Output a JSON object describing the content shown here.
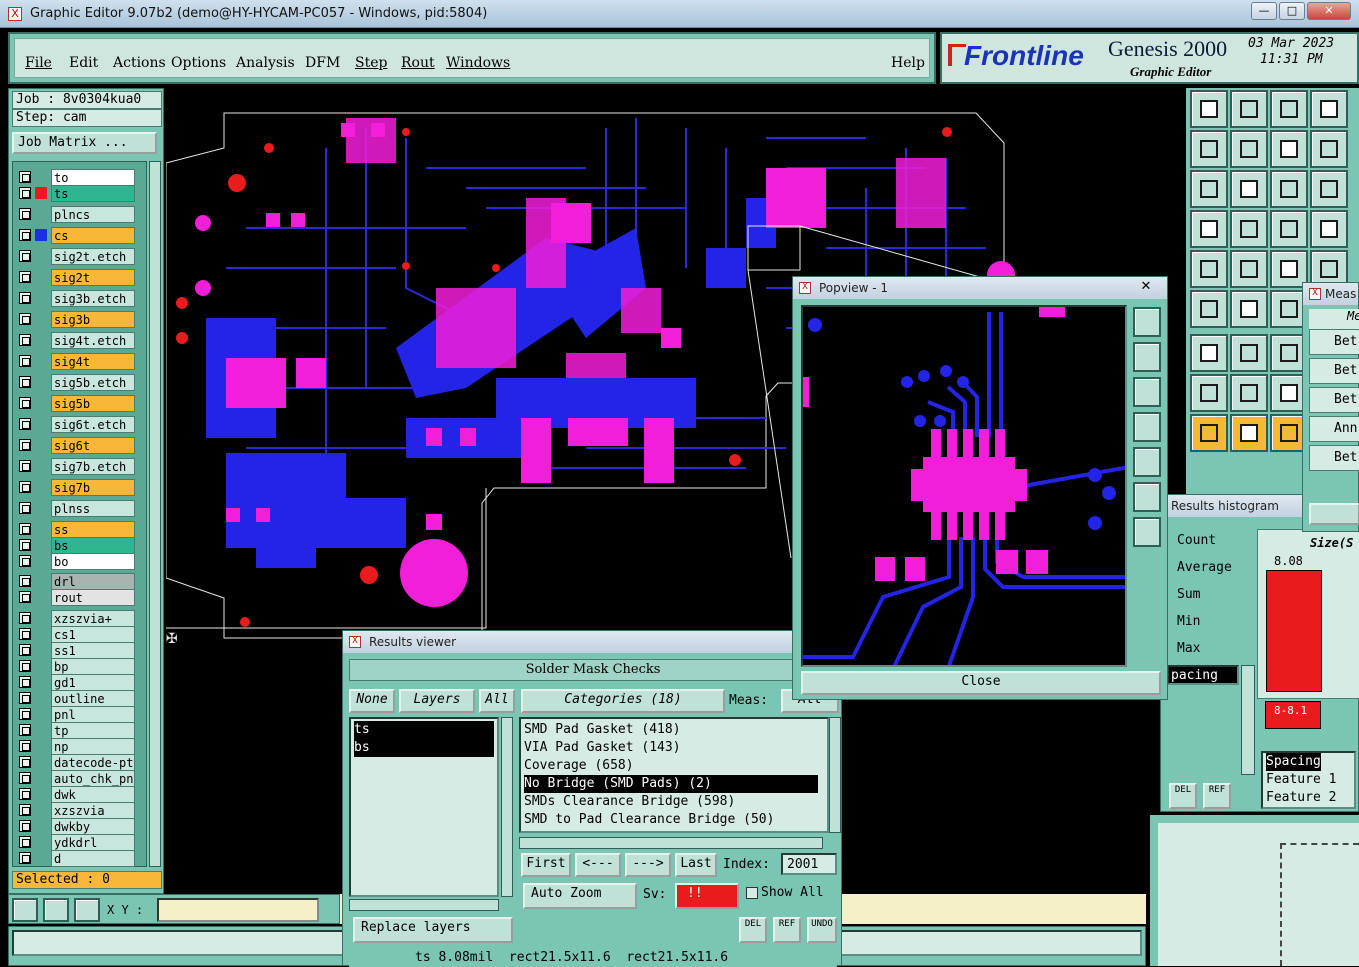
{
  "window": {
    "title": "Graphic Editor 9.07b2 (demo@HY-HYCAM-PC057 - Windows, pid:5804)",
    "app_icon": "X"
  },
  "menu": {
    "file": "File",
    "edit": "Edit",
    "actions": "Actions",
    "options": "Options",
    "analysis": "Analysis",
    "dfm": "DFM",
    "step": "Step",
    "rout": "Rout",
    "windows": "Windows",
    "help": "Help"
  },
  "brand": {
    "logo": "Frontline",
    "product": "Genesis 2000",
    "subtitle": "Graphic Editor",
    "date": "03 Mar 2023",
    "time": "11:31 PM"
  },
  "job": {
    "job_label": "Job : 8v0304kua0",
    "step_label": "Step: cam",
    "matrix_button": "Job Matrix ..."
  },
  "layers": [
    {
      "name": "to",
      "color": "#ffffff",
      "swatch": ""
    },
    {
      "name": "ts",
      "color": "#2fb58f",
      "swatch": "#e81c1c"
    },
    {
      "name": "plncs",
      "color": "#c7e6dd",
      "swatch": ""
    },
    {
      "name": "cs",
      "color": "#f7b83a",
      "swatch": "#1b2ee8"
    },
    {
      "name": "sig2t.etch",
      "color": "#c7e6dd",
      "swatch": ""
    },
    {
      "name": "sig2t",
      "color": "#f7b83a",
      "swatch": ""
    },
    {
      "name": "sig3b.etch",
      "color": "#c7e6dd",
      "swatch": ""
    },
    {
      "name": "sig3b",
      "color": "#f7b83a",
      "swatch": ""
    },
    {
      "name": "sig4t.etch",
      "color": "#c7e6dd",
      "swatch": ""
    },
    {
      "name": "sig4t",
      "color": "#f7b83a",
      "swatch": ""
    },
    {
      "name": "sig5b.etch",
      "color": "#c7e6dd",
      "swatch": ""
    },
    {
      "name": "sig5b",
      "color": "#f7b83a",
      "swatch": ""
    },
    {
      "name": "sig6t.etch",
      "color": "#c7e6dd",
      "swatch": ""
    },
    {
      "name": "sig6t",
      "color": "#f7b83a",
      "swatch": ""
    },
    {
      "name": "sig7b.etch",
      "color": "#c7e6dd",
      "swatch": ""
    },
    {
      "name": "sig7b",
      "color": "#f7b83a",
      "swatch": ""
    },
    {
      "name": "plnss",
      "color": "#c7e6dd",
      "swatch": ""
    },
    {
      "name": "ss",
      "color": "#f7b83a",
      "swatch": ""
    },
    {
      "name": "bs",
      "color": "#2fb58f",
      "swatch": ""
    },
    {
      "name": "bo",
      "color": "#ffffff",
      "swatch": ""
    },
    {
      "name": "drl",
      "color": "#a8b3b0",
      "swatch": ""
    },
    {
      "name": "rout",
      "color": "#e3e3e3",
      "swatch": ""
    },
    {
      "name": "xzszvia+",
      "color": "#c7e6dd",
      "swatch": ""
    },
    {
      "name": "cs1",
      "color": "#c7e6dd",
      "swatch": ""
    },
    {
      "name": "ss1",
      "color": "#c7e6dd",
      "swatch": ""
    },
    {
      "name": "bp",
      "color": "#c7e6dd",
      "swatch": ""
    },
    {
      "name": "gd1",
      "color": "#c7e6dd",
      "swatch": ""
    },
    {
      "name": "outline",
      "color": "#c7e6dd",
      "swatch": ""
    },
    {
      "name": "pnl",
      "color": "#c7e6dd",
      "swatch": ""
    },
    {
      "name": "tp",
      "color": "#c7e6dd",
      "swatch": ""
    },
    {
      "name": "np",
      "color": "#c7e6dd",
      "swatch": ""
    },
    {
      "name": "datecode-pt",
      "color": "#c7e6dd",
      "swatch": ""
    },
    {
      "name": "auto_chk_pnl",
      "color": "#c7e6dd",
      "swatch": ""
    },
    {
      "name": "dwk",
      "color": "#c7e6dd",
      "swatch": ""
    },
    {
      "name": "xzszvia",
      "color": "#c7e6dd",
      "swatch": ""
    },
    {
      "name": "dwkby",
      "color": "#c7e6dd",
      "swatch": ""
    },
    {
      "name": "ydkdrl",
      "color": "#c7e6dd",
      "swatch": ""
    },
    {
      "name": "d",
      "color": "#c7e6dd",
      "swatch": ""
    }
  ],
  "status": {
    "selected": "Selected : 0",
    "xy_label": "X Y :",
    "xy_value": ""
  },
  "results_viewer": {
    "title": "Results viewer",
    "header": "Solder Mask Checks",
    "none": "None",
    "layers": "Layers",
    "all": "All",
    "categories_button": "Categories (18)",
    "meas_label": "Meas:",
    "meas_value": "All",
    "layer_items": [
      "ts",
      "bs"
    ],
    "categories": [
      "SMD Pad Gasket (418)",
      "VIA Pad Gasket (143)",
      "Coverage (658)",
      "No Bridge (SMD Pads) (2)",
      "SMDs Clearance Bridge (598)",
      "SMD to Pad Clearance Bridge (50)"
    ],
    "selected_category": 3,
    "first": "First",
    "prev": "<---",
    "next": "--->",
    "last": "Last",
    "index_label": "Index:",
    "index_value": "2001",
    "auto_zoom": "Auto Zoom",
    "sv_label": "Sv:",
    "sv_value": "!!",
    "show_all": "Show All",
    "replace_layers": "Replace layers",
    "del": "DEL",
    "ref": "REF",
    "undo": "UNDO",
    "status_line": "ts 8.08mil  rect21.5x11.6  rect21.5x11.6"
  },
  "popview": {
    "title": "Popview - 1",
    "close": "Close"
  },
  "histogram": {
    "title": "Results histogram",
    "stats": [
      "Count",
      "Average",
      "Sum",
      "Min",
      "Max"
    ],
    "size_header": "Size(S",
    "bar_value": "8.08",
    "range_label": "8-8.1",
    "selected_text": "pacing",
    "spacing_items": [
      "Spacing",
      "Feature 1",
      "Feature 2"
    ],
    "del": "DEL",
    "ref": "REF"
  },
  "measure": {
    "title": "Meas",
    "header": "Me",
    "options": [
      "Bet",
      "Bet",
      "Bet",
      "Ann",
      "Bet"
    ]
  },
  "colors": {
    "teal": "#7bc6b3",
    "panel": "#d6ebe4",
    "magenta": "#f21fd9",
    "blue": "#2424e6",
    "red": "#e81c1c"
  }
}
